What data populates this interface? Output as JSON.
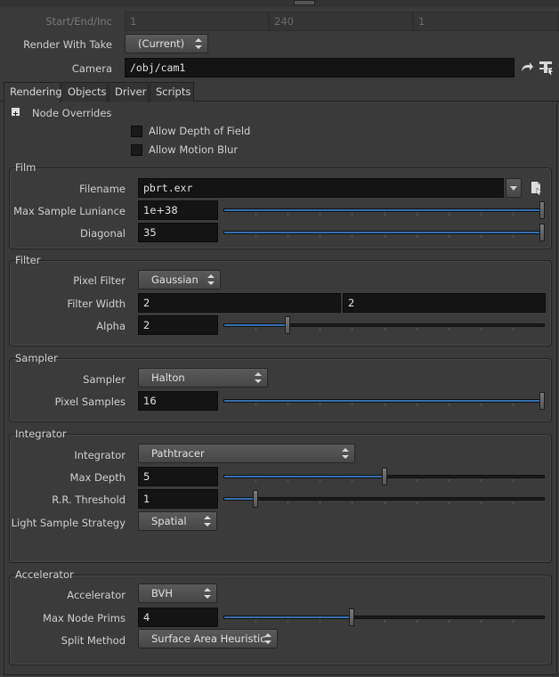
{
  "header": {
    "start_end_inc": {
      "label": "Start/End/Inc",
      "values": [
        "1",
        "240",
        "1"
      ]
    },
    "render_with_take": {
      "label": "Render With Take",
      "value": "(Current)"
    },
    "camera": {
      "label": "Camera",
      "value": "/obj/cam1"
    }
  },
  "tabs": [
    {
      "label": "Rendering",
      "active": true
    },
    {
      "label": "Objects"
    },
    {
      "label": "Driver"
    },
    {
      "label": "Scripts"
    }
  ],
  "node_overrides": {
    "label": "Node Overrides",
    "allow_dof": "Allow Depth of Field",
    "allow_motion_blur": "Allow Motion Blur"
  },
  "film": {
    "title": "Film",
    "filename": {
      "label": "Filename",
      "value": "pbrt.exr"
    },
    "max_sample_luminance": {
      "label": "Max Sample Luniance",
      "value": "1e+38",
      "slider": 1.0
    },
    "diagonal": {
      "label": "Diagonal",
      "value": "35",
      "slider": 1.0
    }
  },
  "filter": {
    "title": "Filter",
    "pixel_filter": {
      "label": "Pixel Filter",
      "value": "Gaussian"
    },
    "filter_width": {
      "label": "Filter Width",
      "values": [
        "2",
        "2"
      ]
    },
    "alpha": {
      "label": "Alpha",
      "value": "2",
      "slider": 0.2
    }
  },
  "sampler": {
    "title": "Sampler",
    "sampler": {
      "label": "Sampler",
      "value": "Halton"
    },
    "pixel_samples": {
      "label": "Pixel Samples",
      "value": "16",
      "slider": 1.0
    }
  },
  "integrator": {
    "title": "Integrator",
    "integrator": {
      "label": "Integrator",
      "value": "Pathtracer"
    },
    "max_depth": {
      "label": "Max Depth",
      "value": "5",
      "slider": 0.5
    },
    "rr_threshold": {
      "label": "R.R. Threshold",
      "value": "1",
      "slider": 0.1
    },
    "light_sample_strategy": {
      "label": "Light Sample Strategy",
      "value": "Spatial"
    }
  },
  "accelerator": {
    "title": "Accelerator",
    "accelerator": {
      "label": "Accelerator",
      "value": "BVH"
    },
    "max_node_prims": {
      "label": "Max Node Prims",
      "value": "4",
      "slider": 0.4
    },
    "split_method": {
      "label": "Split Method",
      "value": "Surface Area Heuristic"
    }
  },
  "colors": {
    "accent": "#3a6fb0",
    "background": "#3a3a3a",
    "field": "#141414"
  }
}
